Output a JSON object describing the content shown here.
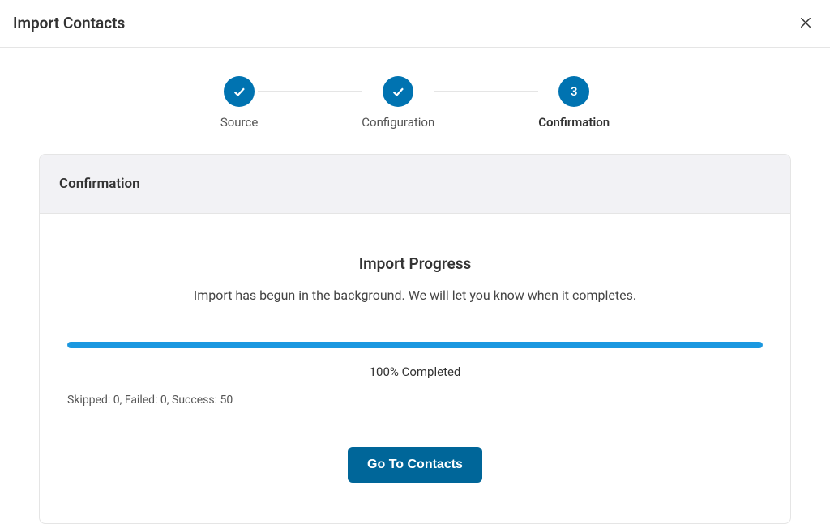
{
  "header": {
    "title": "Import Contacts"
  },
  "stepper": {
    "steps": [
      {
        "label": "Source",
        "state": "done"
      },
      {
        "label": "Configuration",
        "state": "done"
      },
      {
        "label": "Confirmation",
        "state": "active",
        "number": "3"
      }
    ]
  },
  "card": {
    "header": "Confirmation",
    "progress": {
      "title": "Import Progress",
      "subtitle": "Import has begun in the background. We will let you know when it completes.",
      "percent_label": "100% Completed",
      "percent_value": 100,
      "stats": "Skipped: 0, Failed: 0, Success: 50"
    },
    "button_label": "Go To Contacts"
  }
}
